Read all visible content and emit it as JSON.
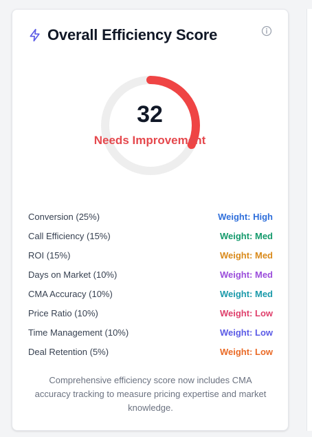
{
  "card": {
    "title": "Overall Efficiency Score",
    "icon": "lightning-bolt-icon",
    "info_icon": "info-icon"
  },
  "gauge": {
    "score": "32",
    "max": 100,
    "status": "Needs Improvement",
    "colors": {
      "track": "#eeeeee",
      "progress": "#ef4444"
    }
  },
  "metrics": [
    {
      "label": "Conversion (25%)",
      "weight": "Weight: High",
      "color": "#2f6fdb"
    },
    {
      "label": "Call Efficiency (15%)",
      "weight": "Weight: Med",
      "color": "#149a6c"
    },
    {
      "label": "ROI (15%)",
      "weight": "Weight: Med",
      "color": "#d98a1b"
    },
    {
      "label": "Days on Market (10%)",
      "weight": "Weight: Med",
      "color": "#9b4ddb"
    },
    {
      "label": "CMA Accuracy (10%)",
      "weight": "Weight: Med",
      "color": "#1b9aaa"
    },
    {
      "label": "Price Ratio (10%)",
      "weight": "Weight: Low",
      "color": "#df3f6b"
    },
    {
      "label": "Time Management (10%)",
      "weight": "Weight: Low",
      "color": "#5b5be6"
    },
    {
      "label": "Deal Retention (5%)",
      "weight": "Weight: Low",
      "color": "#ea6a26"
    }
  ],
  "footer": {
    "text": "Comprehensive efficiency score now includes CMA accuracy tracking to measure pricing expertise and market knowledge."
  }
}
